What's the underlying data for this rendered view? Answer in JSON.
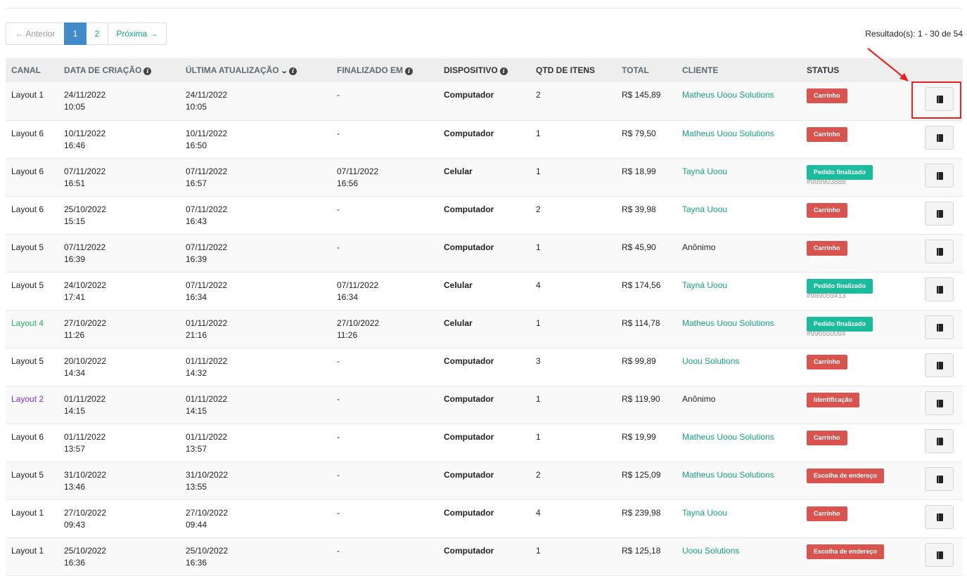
{
  "pagination": {
    "prev_label": "← Anterior",
    "pages": [
      "1",
      "2"
    ],
    "active_page": "1",
    "next_label": "Próxima →"
  },
  "results_text": "Resultado(s): 1 - 30 de 54",
  "table": {
    "headers": {
      "canal": "CANAL",
      "created": "DATA DE CRIAÇÃO",
      "updated": "ÚLTIMA ATUALIZAÇÃO",
      "finished": "FINALIZADO EM",
      "device": "DISPOSITIVO",
      "qty": "QTD DE ITENS",
      "total": "TOTAL",
      "client": "CLIENTE",
      "status": "STATUS"
    },
    "rows": [
      {
        "canal": "Layout 1",
        "canal_color": "#222222",
        "created_date": "24/11/2022",
        "created_time": "10:05",
        "updated_date": "24/11/2022",
        "updated_time": "10:05",
        "finished_date": "-",
        "finished_time": "",
        "device": "Computador",
        "qty": "2",
        "total": "R$ 145,89",
        "client": "Matheus Uoou Solutions",
        "client_link": true,
        "status": "Carrinho",
        "status_color": "#d9534f",
        "order": ""
      },
      {
        "canal": "Layout 6",
        "canal_color": "#222222",
        "created_date": "10/11/2022",
        "created_time": "16:46",
        "updated_date": "10/11/2022",
        "updated_time": "16:50",
        "finished_date": "-",
        "finished_time": "",
        "device": "Computador",
        "qty": "1",
        "total": "R$ 79,50",
        "client": "Matheus Uoou Solutions",
        "client_link": true,
        "status": "Carrinho",
        "status_color": "#d9534f",
        "order": ""
      },
      {
        "canal": "Layout 6",
        "canal_color": "#222222",
        "created_date": "07/11/2022",
        "created_time": "16:51",
        "updated_date": "07/11/2022",
        "updated_time": "16:57",
        "finished_date": "07/11/2022",
        "finished_time": "16:56",
        "device": "Celular",
        "qty": "1",
        "total": "R$ 18,99",
        "client": "Tayná Uoou",
        "client_link": true,
        "status": "Pedido finalizado",
        "status_color": "#1abc9c",
        "order": "#988903888"
      },
      {
        "canal": "Layout 6",
        "canal_color": "#222222",
        "created_date": "25/10/2022",
        "created_time": "15:15",
        "updated_date": "07/11/2022",
        "updated_time": "16:43",
        "finished_date": "-",
        "finished_time": "",
        "device": "Computador",
        "qty": "2",
        "total": "R$ 39,98",
        "client": "Tayná Uoou",
        "client_link": true,
        "status": "Carrinho",
        "status_color": "#d9534f",
        "order": ""
      },
      {
        "canal": "Layout 5",
        "canal_color": "#222222",
        "created_date": "07/11/2022",
        "created_time": "16:39",
        "updated_date": "07/11/2022",
        "updated_time": "16:39",
        "finished_date": "-",
        "finished_time": "",
        "device": "Computador",
        "qty": "1",
        "total": "R$ 45,90",
        "client": "Anônimo",
        "client_link": false,
        "status": "Carrinho",
        "status_color": "#d9534f",
        "order": ""
      },
      {
        "canal": "Layout 5",
        "canal_color": "#222222",
        "created_date": "24/10/2022",
        "created_time": "17:41",
        "updated_date": "07/11/2022",
        "updated_time": "16:34",
        "finished_date": "07/11/2022",
        "finished_time": "16:34",
        "device": "Celular",
        "qty": "4",
        "total": "R$ 174,56",
        "client": "Tayná Uoou",
        "client_link": true,
        "status": "Pedido finalizado",
        "status_color": "#1abc9c",
        "order": "#989059413"
      },
      {
        "canal": "Layout 4",
        "canal_color": "#27ae60",
        "created_date": "27/10/2022",
        "created_time": "11:26",
        "updated_date": "01/11/2022",
        "updated_time": "21:16",
        "finished_date": "27/10/2022",
        "finished_time": "11:26",
        "device": "Celular",
        "qty": "1",
        "total": "R$ 114,78",
        "client": "Matheus Uoou Solutions",
        "client_link": true,
        "status": "Pedido finalizado",
        "status_color": "#1abc9c",
        "order": "#996550084"
      },
      {
        "canal": "Layout 5",
        "canal_color": "#222222",
        "created_date": "20/10/2022",
        "created_time": "14:34",
        "updated_date": "01/11/2022",
        "updated_time": "14:32",
        "finished_date": "-",
        "finished_time": "",
        "device": "Computador",
        "qty": "3",
        "total": "R$ 99,89",
        "client": "Uoou Solutions",
        "client_link": true,
        "status": "Carrinho",
        "status_color": "#d9534f",
        "order": ""
      },
      {
        "canal": "Layout 2",
        "canal_color": "#8e2de2",
        "created_date": "01/11/2022",
        "created_time": "14:15",
        "updated_date": "01/11/2022",
        "updated_time": "14:15",
        "finished_date": "-",
        "finished_time": "",
        "device": "Computador",
        "qty": "1",
        "total": "R$ 119,90",
        "client": "Anônimo",
        "client_link": false,
        "status": "Identificação",
        "status_color": "#d9534f",
        "order": ""
      },
      {
        "canal": "Layout 6",
        "canal_color": "#222222",
        "created_date": "01/11/2022",
        "created_time": "13:57",
        "updated_date": "01/11/2022",
        "updated_time": "13:57",
        "finished_date": "-",
        "finished_time": "",
        "device": "Computador",
        "qty": "1",
        "total": "R$ 19,99",
        "client": "Matheus Uoou Solutions",
        "client_link": true,
        "status": "Carrinho",
        "status_color": "#d9534f",
        "order": ""
      },
      {
        "canal": "Layout 5",
        "canal_color": "#222222",
        "created_date": "31/10/2022",
        "created_time": "13:46",
        "updated_date": "31/10/2022",
        "updated_time": "13:55",
        "finished_date": "-",
        "finished_time": "",
        "device": "Computador",
        "qty": "2",
        "total": "R$ 125,09",
        "client": "Matheus Uoou Solutions",
        "client_link": true,
        "status": "Escolha de endereço",
        "status_color": "#d9534f",
        "order": ""
      },
      {
        "canal": "Layout 1",
        "canal_color": "#222222",
        "created_date": "27/10/2022",
        "created_time": "09:43",
        "updated_date": "27/10/2022",
        "updated_time": "09:44",
        "finished_date": "-",
        "finished_time": "",
        "device": "Computador",
        "qty": "4",
        "total": "R$ 239,98",
        "client": "Tayná Uoou",
        "client_link": true,
        "status": "Carrinho",
        "status_color": "#d9534f",
        "order": ""
      },
      {
        "canal": "Layout 1",
        "canal_color": "#222222",
        "created_date": "25/10/2022",
        "created_time": "16:36",
        "updated_date": "25/10/2022",
        "updated_time": "16:36",
        "finished_date": "-",
        "finished_time": "",
        "device": "Computador",
        "qty": "1",
        "total": "R$ 125,18",
        "client": "Uoou Solutions",
        "client_link": true,
        "status": "Escolha de endereço",
        "status_color": "#d9534f",
        "order": ""
      }
    ]
  },
  "colors": {
    "link": "#16a085",
    "pager_active": "#428bca",
    "badge_red": "#d9534f",
    "badge_green": "#1abc9c",
    "annotation_red": "#e8231f"
  },
  "icons": {
    "info": "info-icon",
    "sort": "chevron-down-icon",
    "view": "book-icon",
    "annotation": "arrow-annotation"
  }
}
